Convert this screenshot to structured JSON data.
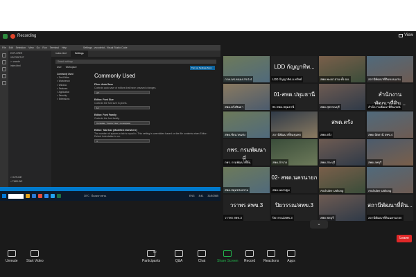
{
  "zoom": {
    "recording_label": "Recording",
    "view_label": "View",
    "leave_label": "Leave"
  },
  "vscode": {
    "title": "Settings - vscodetut - Visual Studio Code",
    "menu": [
      "File",
      "Edit",
      "Selection",
      "View",
      "Go",
      "Run",
      "Terminal",
      "Help"
    ],
    "explorer_title": "EXPLORER",
    "explorer_items": [
      "VSCODETUT",
      "> .vscode",
      "index.html"
    ],
    "outline": "> OUTLINE",
    "timeline": "> TIMELINE",
    "tabs": [
      "index.html",
      "Settings"
    ],
    "search_placeholder": "Search settings",
    "scopes": [
      "User",
      "Workspace"
    ],
    "sync_button": "Turn on Settings Sync",
    "tree": [
      "Commonly Used",
      "> Text Editor",
      "> Workbench",
      "> Window",
      "> Features",
      "> Application",
      "> Security",
      "> Extensions"
    ],
    "heading": "Commonly Used",
    "settings": [
      {
        "title": "Files: Auto Save",
        "desc": "Controls auto save of editors that have unsaved changes.",
        "value": "off"
      },
      {
        "title": "Editor: Font Size",
        "desc": "Controls the font size in pixels.",
        "value": "14"
      },
      {
        "title": "Editor: Font Family",
        "desc": "Controls the font family.",
        "value": "Consolas, 'Courier New', monospace"
      },
      {
        "title": "Editor: Tab Size (Modified elsewhere)",
        "desc": "The number of spaces a tab is equal to. This setting is overridden based on the file contents when Editor: Detect Indentation is on.",
        "value": "4"
      }
    ]
  },
  "taskbar": {
    "weather": "30°C",
    "weather_label": "มีแดดบางส่วน",
    "lang": "ENG",
    "time": "8:41",
    "date": "31/5/2565"
  },
  "tiles": [
    {
      "label": "ภาค.ฉช.หนอง สร.6.4",
      "big": ""
    },
    {
      "label": "LDD กัญญาทิต.ม.ทรัพย์",
      "big": "LDD กัญญาทิพ..."
    },
    {
      "label": "สพด.พะเยาอ่าน-ทั้ง ฉบ.",
      "big": ""
    },
    {
      "label": "สถานีพัฒนาที่ดินขอนแก่น",
      "big": ""
    },
    {
      "label": "สพด.ตรังชินธา",
      "big": ""
    },
    {
      "label": "01-สพด.ปทุมธานี",
      "big": "01-สพด.ปทุมธานี"
    },
    {
      "label": "สพด.สุพรรณบุรี",
      "big": ""
    },
    {
      "label": "สำนักงานพัฒนาที่ดินเขต1",
      "big": "สำนักงานพัฒนาที่ดิน..."
    },
    {
      "label": "สพด.ชัยนาทแห่ง",
      "big": ""
    },
    {
      "label": "สถานีพัฒนาที่ดินชุมพร",
      "big": ""
    },
    {
      "label": "สพด.ตรัง",
      "big": "สพด.ตรัง"
    },
    {
      "label": "สพด.ปัตตานี สพข.4",
      "big": ""
    },
    {
      "label": "กพร. กรมพัฒนาที่ดิน",
      "big": "กพร. กรมพัฒนาที่..."
    },
    {
      "label": "สพด.ลำปาง",
      "big": ""
    },
    {
      "label": "สพด.สระบุรี",
      "big": ""
    },
    {
      "label": "สพด.ลพบุรี",
      "big": ""
    },
    {
      "label": "สพด.สมุทรสงคราม",
      "big": ""
    },
    {
      "label": "สพด.นครปฐม",
      "big": "02- สพด.นครนายก"
    },
    {
      "label": "Anchulee Utthong",
      "big": ""
    },
    {
      "label": "Anchulee Utthong",
      "big": ""
    },
    {
      "label": "วราพร สพข.3",
      "big": "วราพร สพข.3"
    },
    {
      "label": "ปิยวรรณ/สพข.3",
      "big": "ปิยวรรณ/สพข.3"
    },
    {
      "label": "สพด.ชลบุรี",
      "big": ""
    },
    {
      "label": "สถานีพัฒนาที่ดินนครนายก",
      "big": "สถานีพัฒนาที่ดิน..."
    }
  ],
  "controls": [
    {
      "label": "Unmute",
      "icon": "mic-muted-icon"
    },
    {
      "label": "Start Video",
      "icon": "video-off-icon"
    },
    {
      "label": "Participants",
      "count": "60",
      "icon": "participants-icon"
    },
    {
      "label": "Q&A",
      "icon": "qa-icon"
    },
    {
      "label": "Chat",
      "icon": "chat-icon"
    },
    {
      "label": "Share Screen",
      "icon": "share-screen-icon"
    },
    {
      "label": "Record",
      "icon": "record-icon"
    },
    {
      "label": "Reactions",
      "icon": "reactions-icon"
    },
    {
      "label": "Apps",
      "icon": "apps-icon"
    }
  ]
}
